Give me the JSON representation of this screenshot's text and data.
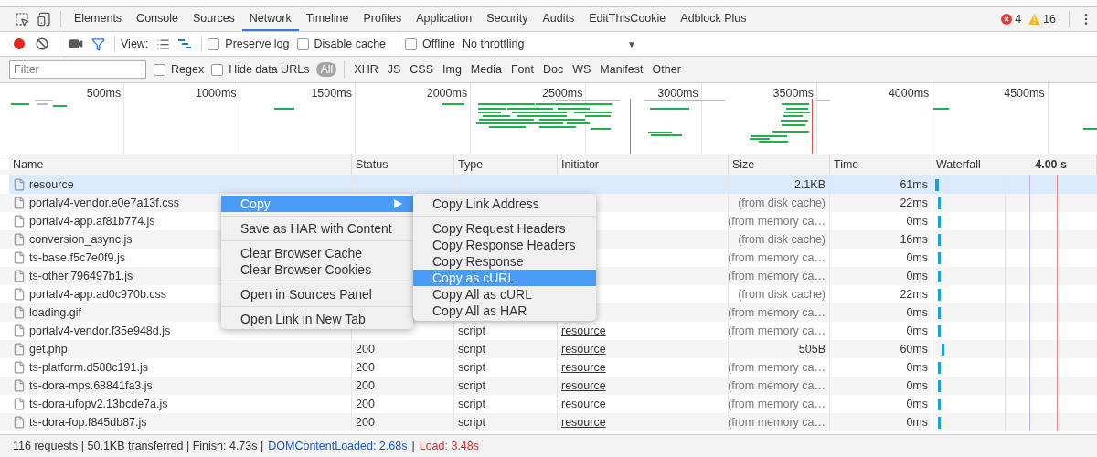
{
  "tabs": [
    {
      "label": "Elements",
      "selected": false
    },
    {
      "label": "Console",
      "selected": false
    },
    {
      "label": "Sources",
      "selected": false
    },
    {
      "label": "Network",
      "selected": true
    },
    {
      "label": "Timeline",
      "selected": false
    },
    {
      "label": "Profiles",
      "selected": false
    },
    {
      "label": "Application",
      "selected": false
    },
    {
      "label": "Security",
      "selected": false
    },
    {
      "label": "Audits",
      "selected": false
    },
    {
      "label": "EditThisCookie",
      "selected": false
    },
    {
      "label": "Adblock Plus",
      "selected": false
    }
  ],
  "console_counts": {
    "errors": "4",
    "warnings": "16"
  },
  "toolbar": {
    "recording": true,
    "filter_active": true,
    "view_label": "View:",
    "views": [
      {
        "kind": "list",
        "selected": false
      },
      {
        "kind": "waterfall",
        "selected": true
      }
    ],
    "options": [
      {
        "label": "Preserve log",
        "checked": false
      },
      {
        "label": "Disable cache",
        "checked": false
      }
    ],
    "offline": {
      "label": "Offline",
      "checked": false
    },
    "throttling": "No throttling",
    "throttling_arrow": "▼"
  },
  "filter_bar": {
    "placeholder": "Filter",
    "options": [
      {
        "label": "Regex",
        "checked": false
      },
      {
        "label": "Hide data URLs",
        "checked": false
      }
    ],
    "types": [
      {
        "label": "All",
        "selected": true
      },
      {
        "label": "XHR",
        "selected": false
      },
      {
        "label": "JS",
        "selected": false
      },
      {
        "label": "CSS",
        "selected": false
      },
      {
        "label": "Img",
        "selected": false
      },
      {
        "label": "Media",
        "selected": false
      },
      {
        "label": "Font",
        "selected": false
      },
      {
        "label": "Doc",
        "selected": false
      },
      {
        "label": "WS",
        "selected": false
      },
      {
        "label": "Manifest",
        "selected": false
      },
      {
        "label": "Other",
        "selected": false
      }
    ]
  },
  "overview": {
    "ticks": [
      "500ms",
      "1000ms",
      "1500ms",
      "2000ms",
      "2500ms",
      "3000ms",
      "3500ms",
      "4000ms",
      "4500ms"
    ]
  },
  "table": {
    "columns": [
      "Name",
      "Status",
      "Type",
      "Initiator",
      "Size",
      "Time",
      "Waterfall"
    ],
    "waterfall_scale": "4.00 s",
    "rows": [
      {
        "name": "resource",
        "size": "2.1KB",
        "cached": false,
        "time": "61ms",
        "selected": true
      },
      {
        "name": "portalv4-vendor.e0e7a13f.css",
        "size": "(from disk cache)",
        "cached": true,
        "time": "22ms",
        "selected": false
      },
      {
        "name": "portalv4-app.af81b774.js",
        "size": "(from memory ca…",
        "cached": true,
        "time": "0ms",
        "selected": false
      },
      {
        "name": "conversion_async.js",
        "size": "(from disk cache)",
        "cached": true,
        "time": "16ms",
        "selected": false
      },
      {
        "name": "ts-base.f5c7e0f9.js",
        "size": "(from memory ca…",
        "cached": true,
        "time": "0ms",
        "selected": false
      },
      {
        "name": "ts-other.796497b1.js",
        "size": "(from memory ca…",
        "cached": true,
        "time": "0ms",
        "selected": false
      },
      {
        "name": "portalv4-app.ad0c970b.css",
        "size": "(from disk cache)",
        "cached": true,
        "time": "22ms",
        "selected": false
      },
      {
        "name": "loading.gif",
        "size": "(from memory ca…",
        "cached": true,
        "time": "0ms",
        "selected": false
      },
      {
        "name": "portalv4-vendor.f35e948d.js",
        "type": "script",
        "initiator": "resource",
        "size": "(from memory ca…",
        "cached": true,
        "time": "0ms",
        "selected": false
      },
      {
        "name": "get.php",
        "status": "200",
        "type": "script",
        "initiator": "resource",
        "size": "505B",
        "cached": false,
        "time": "60ms",
        "selected": false
      },
      {
        "name": "ts-platform.d588c191.js",
        "status": "200",
        "type": "script",
        "initiator": "resource",
        "size": "(from memory ca…",
        "cached": true,
        "time": "0ms",
        "selected": false
      },
      {
        "name": "ts-dora-mps.68841fa3.js",
        "status": "200",
        "type": "script",
        "initiator": "resource",
        "size": "(from memory ca…",
        "cached": true,
        "time": "0ms",
        "selected": false
      },
      {
        "name": "ts-dora-ufopv2.13bcde7a.js",
        "status": "200",
        "type": "script",
        "initiator": "resource",
        "size": "(from memory ca…",
        "cached": true,
        "time": "0ms",
        "selected": false
      },
      {
        "name": "ts-dora-fop.f845db87.js",
        "status": "200",
        "type": "script",
        "initiator": "resource",
        "size": "(from memory ca…",
        "cached": true,
        "time": "0ms",
        "selected": false
      }
    ]
  },
  "context_menu": {
    "groups": [
      [
        {
          "label": "Copy",
          "selected": true,
          "submenu": true
        }
      ],
      [
        {
          "label": "Save as HAR with Content",
          "selected": false,
          "submenu": false
        }
      ],
      [
        {
          "label": "Clear Browser Cache",
          "selected": false,
          "submenu": false
        },
        {
          "label": "Clear Browser Cookies",
          "selected": false,
          "submenu": false
        }
      ],
      [
        {
          "label": "Open in Sources Panel",
          "selected": false,
          "submenu": false
        }
      ],
      [
        {
          "label": "Open Link in New Tab",
          "selected": false,
          "submenu": false
        }
      ]
    ]
  },
  "submenu": {
    "groups": [
      [
        {
          "label": "Copy Link Address",
          "selected": false
        }
      ],
      [
        {
          "label": "Copy Request Headers",
          "selected": false
        },
        {
          "label": "Copy Response Headers",
          "selected": false
        },
        {
          "label": "Copy Response",
          "selected": false
        },
        {
          "label": "Copy as cURL",
          "selected": true
        },
        {
          "label": "Copy All as cURL",
          "selected": false
        },
        {
          "label": "Copy All as HAR",
          "selected": false
        }
      ]
    ]
  },
  "status_bar": [
    {
      "text": "116 requests | 50.1KB transferred | Finish: 4.73s |",
      "kind": "plain"
    },
    {
      "text": "DOMContentLoaded: 2.68s",
      "kind": "dom"
    },
    {
      "text": "|",
      "kind": "plain"
    },
    {
      "text": "Load: 3.48s",
      "kind": "load"
    }
  ]
}
